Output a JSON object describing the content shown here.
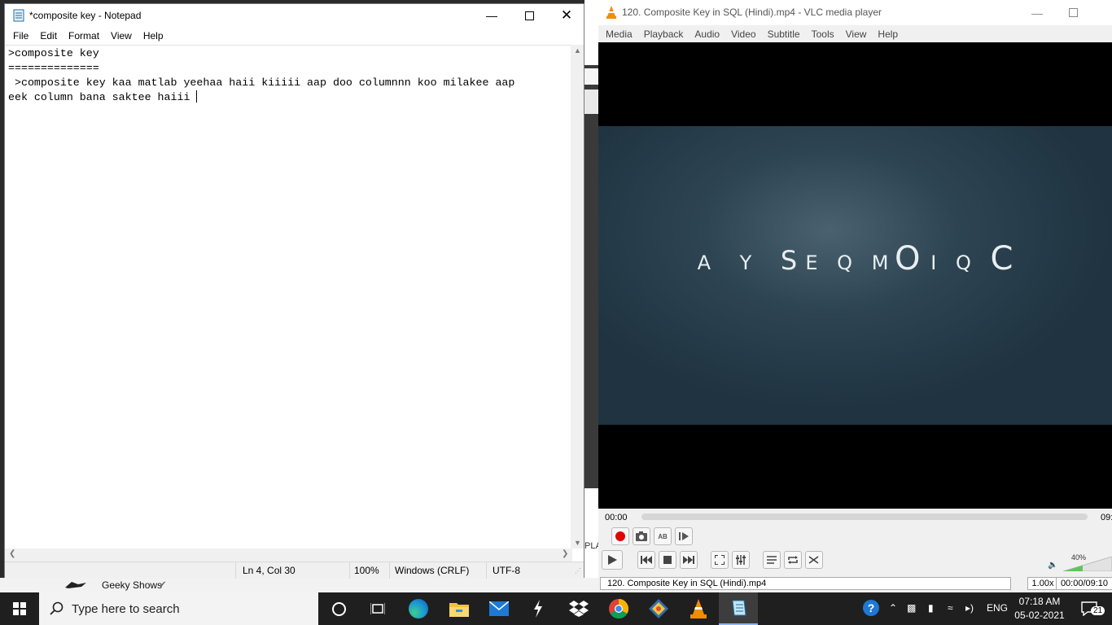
{
  "background": {
    "channel_name": "Geeky Shows",
    "partial_text": "PLA"
  },
  "notepad": {
    "title": "*composite key - Notepad",
    "menu": [
      "File",
      "Edit",
      "Format",
      "View",
      "Help"
    ],
    "lines": [
      ">composite key",
      "==============",
      " >composite key kaa matlab yeehaa haii kiiiii aap doo columnnn koo milakee aap",
      "eek column bana saktee haiii "
    ],
    "status": {
      "position": "Ln 4, Col 30",
      "zoom": "100%",
      "line_ending": "Windows (CRLF)",
      "encoding": "UTF-8"
    }
  },
  "vlc": {
    "title": "120. Composite Key in SQL (Hindi).mp4 - VLC media player",
    "menu": [
      "Media",
      "Playback",
      "Audio",
      "Video",
      "Subtitle",
      "Tools",
      "View",
      "Help"
    ],
    "video_text": "AYSEQ MOIQC",
    "time_elapsed": "00:00",
    "time_total_partial": "09:",
    "volume": "40%",
    "status_file": "120. Composite Key in SQL (Hindi).mp4",
    "speed": "1.00x",
    "time_display": "00:00/09:10",
    "colors": {
      "record": "#e00000",
      "volume_fill": "#5cc85c"
    }
  },
  "taskbar": {
    "search_placeholder": "Type here to search",
    "language": "ENG",
    "time": "07:18 AM",
    "date": "05-02-2021",
    "notifications": "21"
  }
}
